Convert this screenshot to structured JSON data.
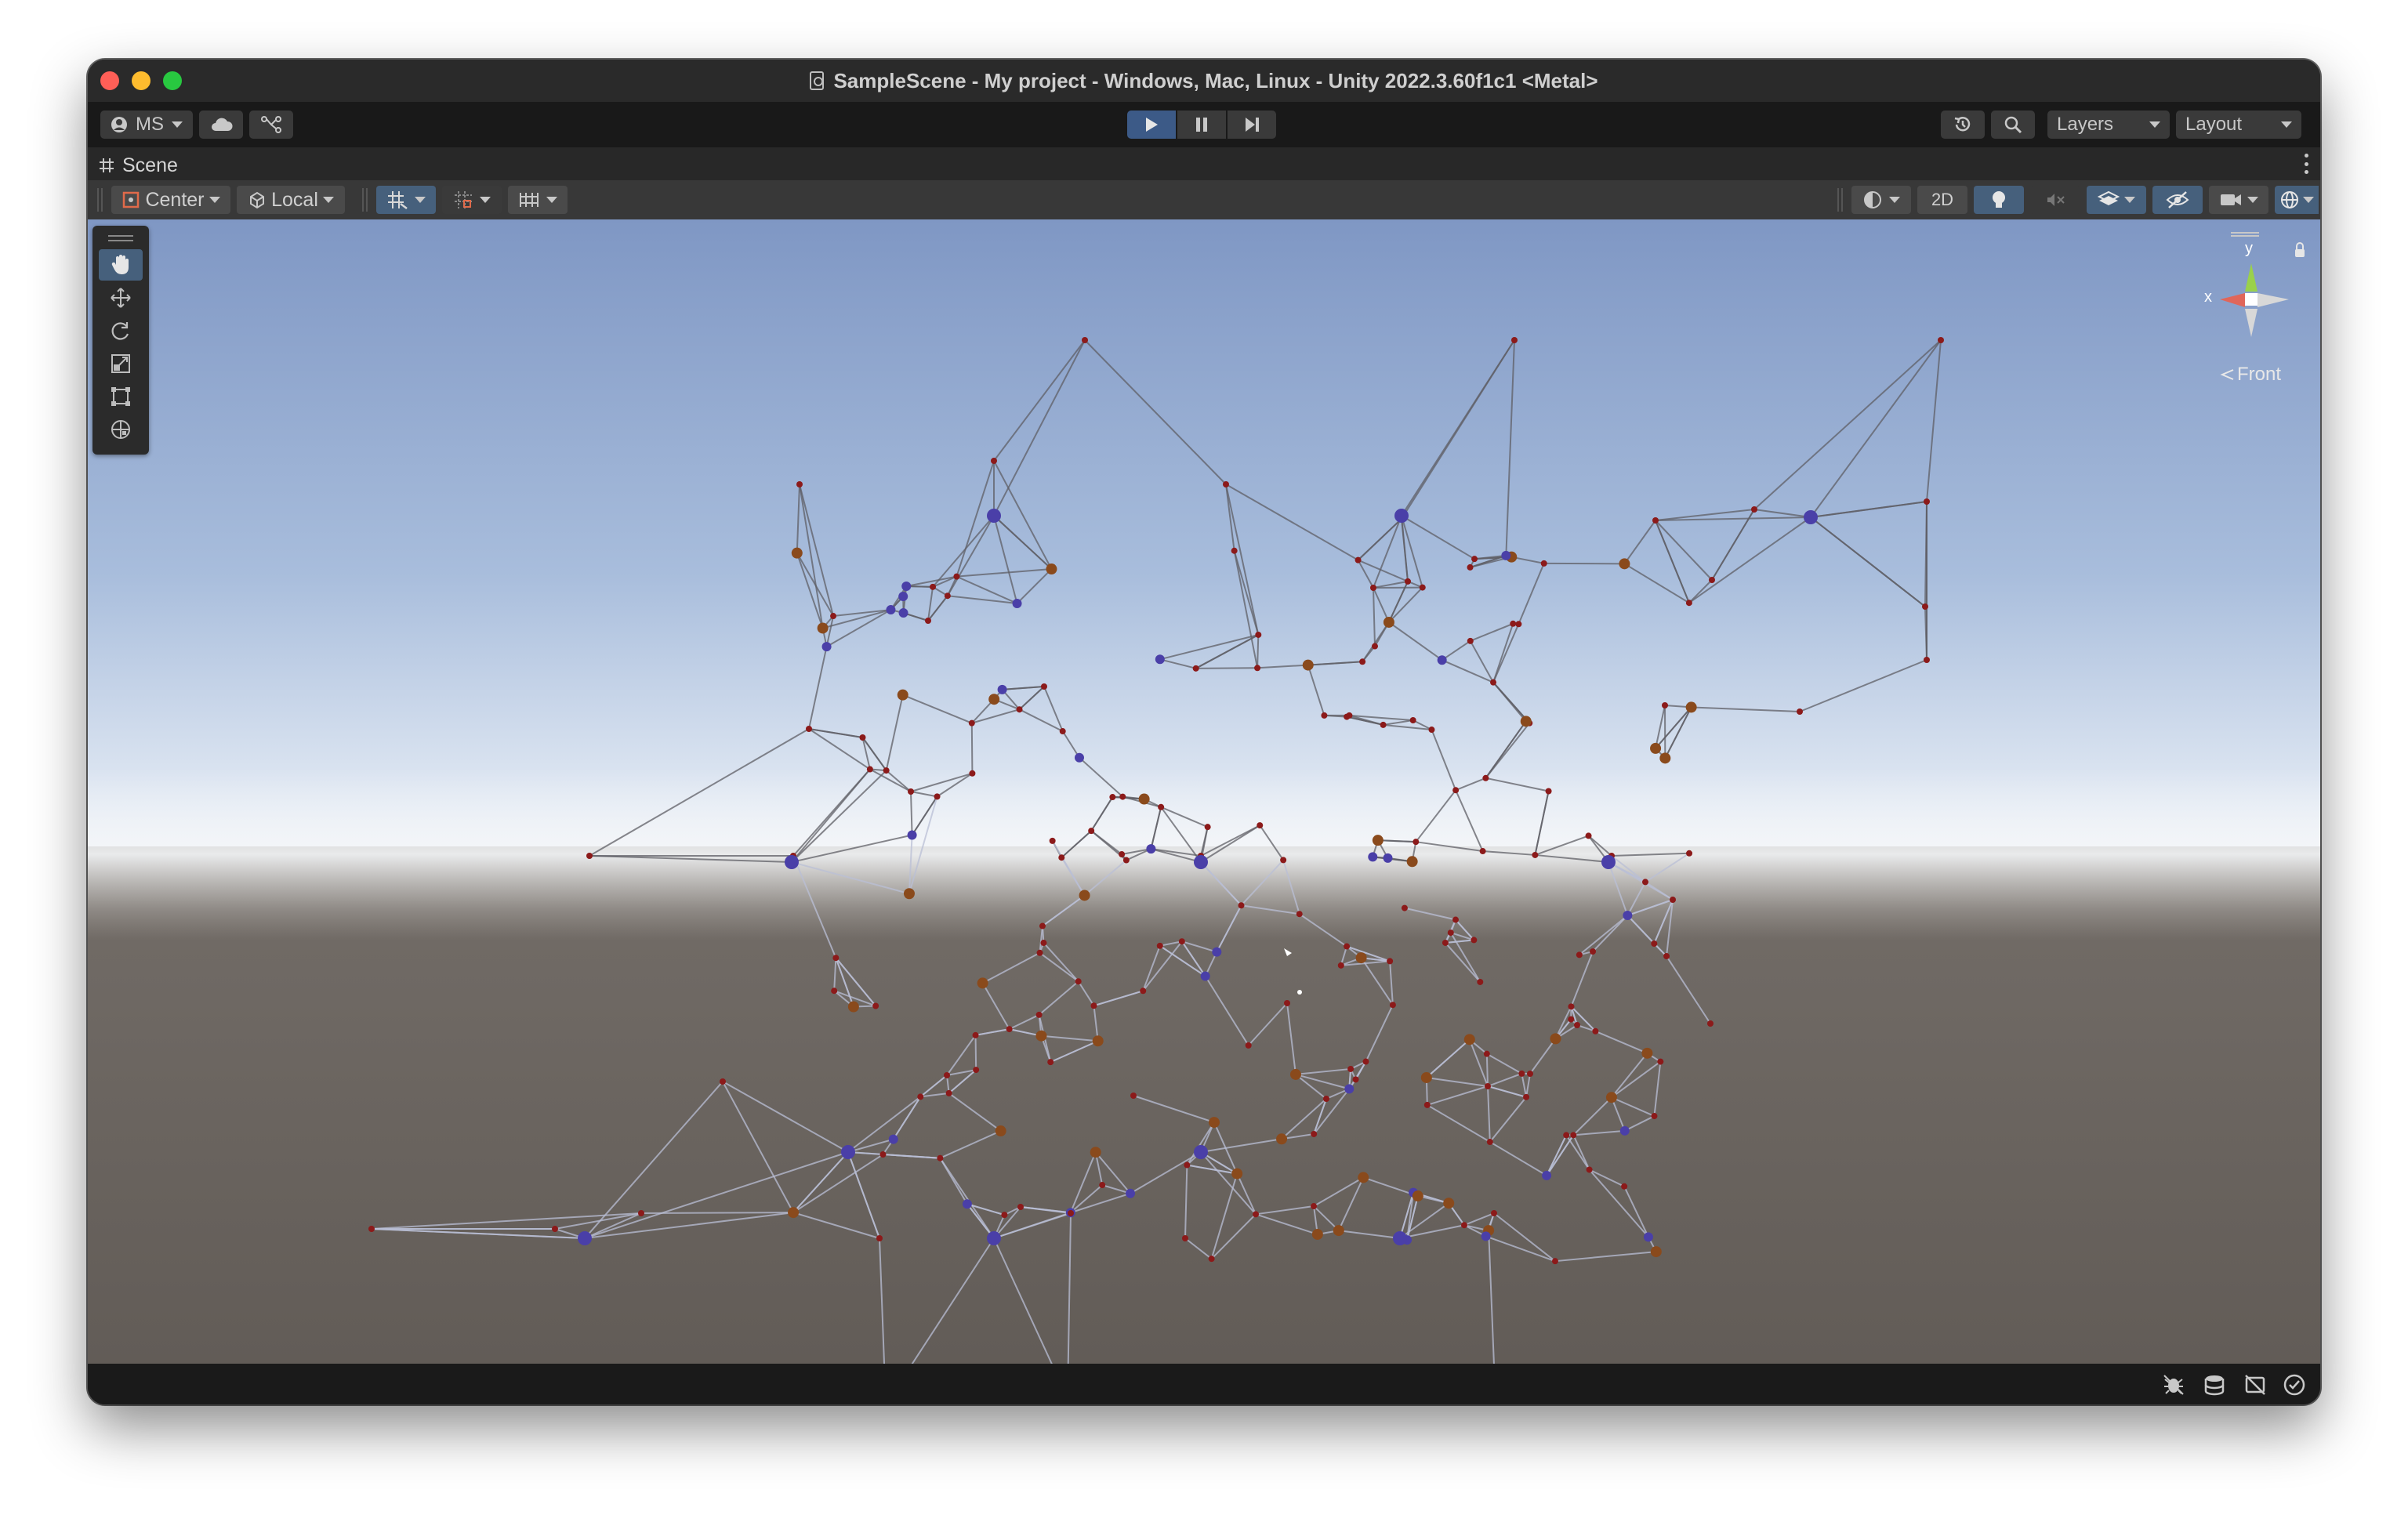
{
  "window": {
    "title": "SampleScene - My project - Windows, Mac, Linux - Unity 2022.3.60f1c1 <Metal>"
  },
  "toolbar": {
    "account_label": "MS",
    "cloud_icon": "cloud-icon",
    "collab_icon": "version-control-icon",
    "play_icon": "play-icon",
    "pause_icon": "pause-icon",
    "step_icon": "step-icon",
    "history_icon": "history-icon",
    "search_icon": "search-icon",
    "layers_label": "Layers",
    "layout_label": "Layout"
  },
  "tab": {
    "label": "Scene",
    "icon": "grid-icon"
  },
  "scene_toolbar": {
    "pivot_label": "Center",
    "space_label": "Local",
    "mode_2d_label": "2D"
  },
  "gizmo": {
    "x_label": "x",
    "y_label": "y",
    "view_label": "Front"
  },
  "tools": [
    "hand-tool",
    "move-tool",
    "rotate-tool",
    "scale-tool",
    "rect-tool",
    "transform-tool"
  ],
  "status_icons": [
    "debug-icon",
    "cache-icon",
    "notification-off-icon",
    "checkmark-icon"
  ],
  "colors": {
    "accent": "#46607c",
    "play_active": "#3c5a87",
    "sky_top": "#8a9fc8",
    "ground": "#6b6560",
    "node_red": "#8c1a1a",
    "node_blue": "#4a3fa8",
    "node_orange": "#8a4a1c"
  }
}
